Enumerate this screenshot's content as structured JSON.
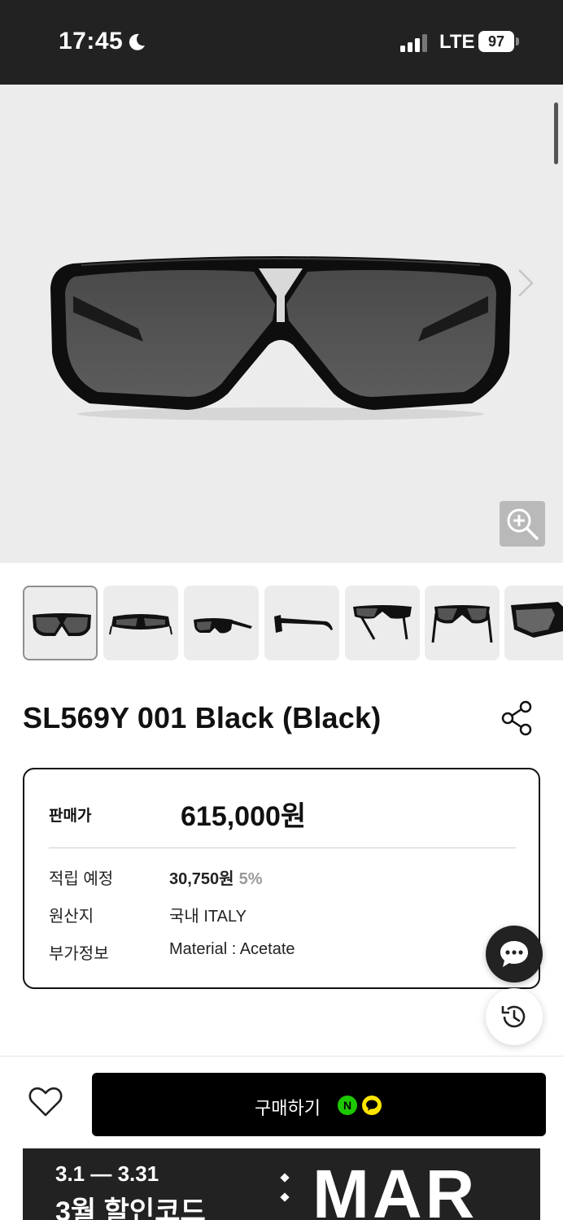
{
  "status_bar": {
    "time": "17:45",
    "network": "LTE",
    "battery": "97",
    "icons": [
      "moon-icon",
      "signal-icon",
      "battery-icon"
    ]
  },
  "gallery": {
    "main_image": "black-aviator-sunglasses-front",
    "thumbnails": [
      {
        "view": "front",
        "active": true
      },
      {
        "view": "top-angle",
        "active": false
      },
      {
        "view": "three-quarter",
        "active": false
      },
      {
        "view": "side",
        "active": false
      },
      {
        "view": "back-angle",
        "active": false
      },
      {
        "view": "back",
        "active": false
      },
      {
        "view": "close-up",
        "active": false
      }
    ]
  },
  "product": {
    "title": "SL569Y 001 Black (Black)",
    "price_label": "판매가",
    "price": "615,000원",
    "points_label": "적립 예정",
    "points": "30,750원",
    "points_rate": "5%",
    "origin_label": "원산지",
    "origin": "국내 ITALY",
    "extra_label": "부가정보",
    "extra": "Material : Acetate"
  },
  "actions": {
    "buy_label": "구매하기",
    "npay_glyph": "N"
  },
  "banner": {
    "dates": "3.1 — 3.31",
    "code_text": "3월 할인코드",
    "month": "MAR"
  },
  "colors": {
    "status_bg": "#222222",
    "hero_bg": "#ececec",
    "button_bg": "#000000",
    "npay_green": "#1ec800",
    "kakao_yellow": "#fee500"
  }
}
